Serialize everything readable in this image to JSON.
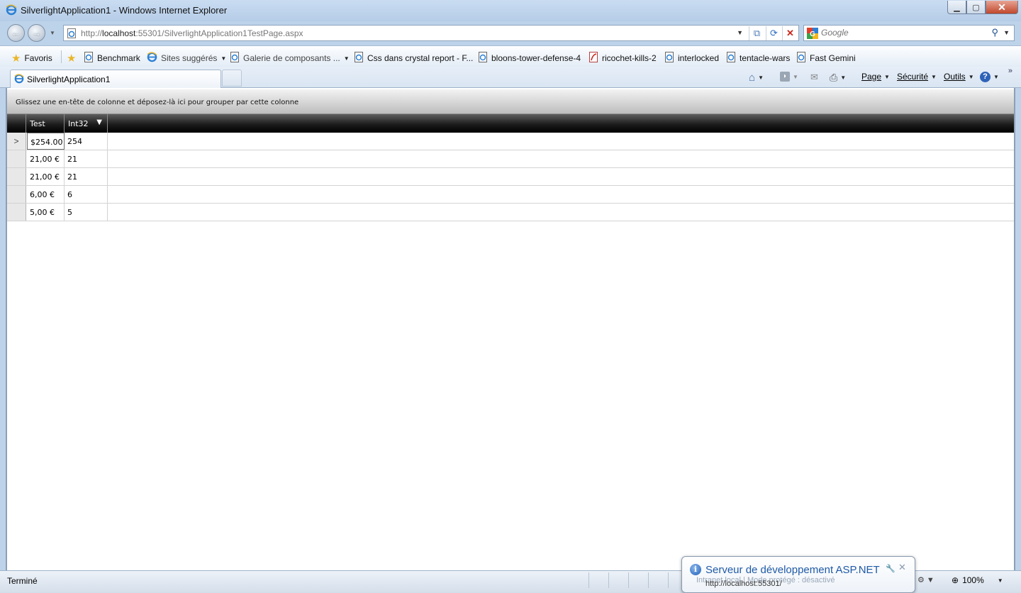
{
  "window": {
    "title": "SilverlightApplication1 - Windows Internet Explorer"
  },
  "address_bar": {
    "url_prefix": "http://",
    "url_host": "localhost",
    "url_rest": ":55301/SilverlightApplication1TestPage.aspx"
  },
  "search": {
    "placeholder": "Google"
  },
  "favorites_bar": {
    "favorites_label": "Favoris",
    "items": [
      {
        "label": "Benchmark",
        "icon": "ie-page-icon"
      },
      {
        "label": "Sites suggérés",
        "icon": "ie-logo-icon",
        "dropdown": true
      },
      {
        "label": "Galerie de composants ...",
        "icon": "ie-page-icon",
        "dropdown": true
      },
      {
        "label": "Css dans crystal report - F...",
        "icon": "ie-page-icon"
      },
      {
        "label": "bloons-tower-defense-4",
        "icon": "ie-page-icon"
      },
      {
        "label": "ricochet-kills-2",
        "icon": "flash-page-icon"
      },
      {
        "label": "interlocked",
        "icon": "ie-page-icon"
      },
      {
        "label": "tentacle-wars",
        "icon": "ie-page-icon"
      },
      {
        "label": "Fast Gemini",
        "icon": "ie-page-icon"
      }
    ]
  },
  "tabs": [
    {
      "label": "SilverlightApplication1",
      "active": true
    }
  ],
  "command_bar": {
    "page": "Page",
    "security": "Sécurité",
    "tools": "Outils"
  },
  "grid": {
    "group_panel_text": "Glissez une en-tête de colonne et déposez-là ici pour grouper par cette colonne",
    "columns": [
      "Test",
      "Int32"
    ],
    "rows": [
      {
        "test": "$254.00",
        "int32": "254",
        "current": true
      },
      {
        "test": "21,00 €",
        "int32": "21",
        "current": false
      },
      {
        "test": "21,00 €",
        "int32": "21",
        "current": false
      },
      {
        "test": "6,00 €",
        "int32": "6",
        "current": false
      },
      {
        "test": "5,00 €",
        "int32": "5",
        "current": false
      }
    ]
  },
  "status_bar": {
    "status": "Terminé",
    "zone_ghost": "Intranet local | Mode protégé : désactivé",
    "zoom": "100%"
  },
  "notification": {
    "title": "Serveur de développement ASP.NET",
    "url": "http://localhost:55301/"
  },
  "colors": {
    "chrome": "#bcd3ea",
    "grid_header": "#1c1c1c",
    "link_blue": "#1f5aa6"
  }
}
